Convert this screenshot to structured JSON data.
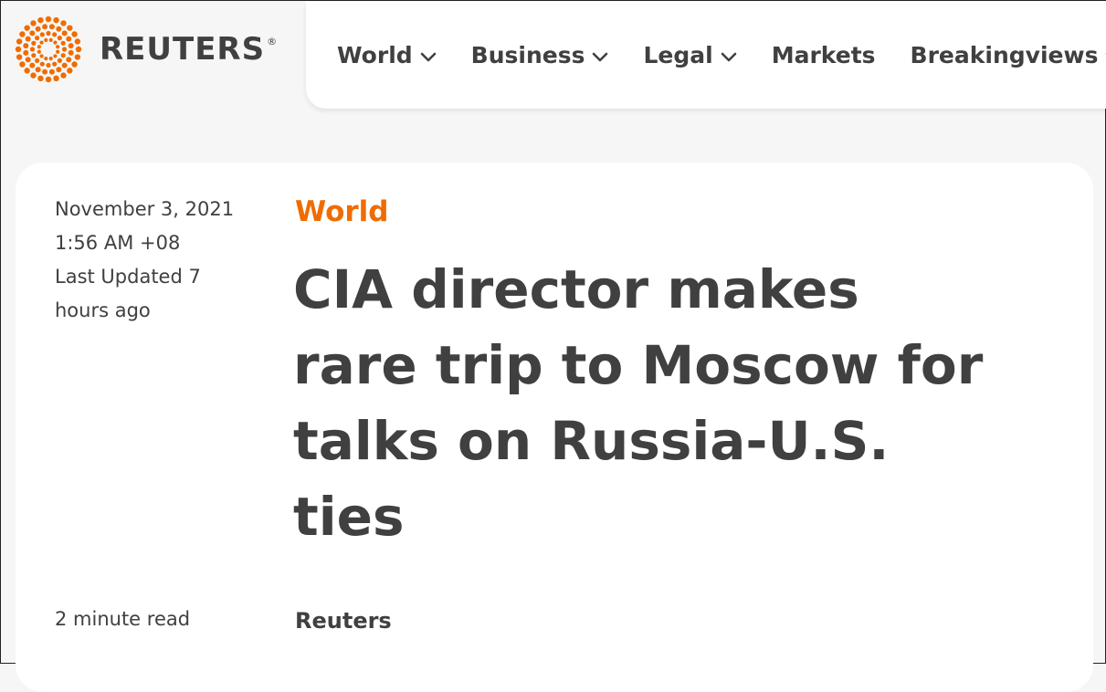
{
  "brand": {
    "name": "REUTERS",
    "registered_mark": "®",
    "logo_icon": "reuters-dot-circle",
    "accent_color": "#ef6c00"
  },
  "nav": {
    "items": [
      {
        "label": "World",
        "has_dropdown": true
      },
      {
        "label": "Business",
        "has_dropdown": true
      },
      {
        "label": "Legal",
        "has_dropdown": true
      },
      {
        "label": "Markets",
        "has_dropdown": false
      },
      {
        "label": "Breakingviews",
        "has_dropdown": true
      }
    ]
  },
  "article": {
    "date": "November 3, 2021",
    "time": "1:56 AM +08",
    "updated_line1": "Last Updated 7",
    "updated_line2": "hours ago",
    "read_time": "2 minute read",
    "category": "World",
    "headline": "CIA director makes rare trip to Moscow for talks on Russia-U.S. ties",
    "byline": "Reuters"
  }
}
